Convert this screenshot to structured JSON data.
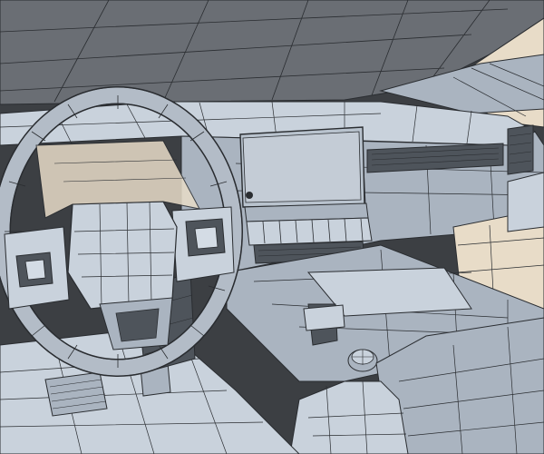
{
  "scene": {
    "subject": "car-interior-wireframe-render",
    "colors": {
      "background": "#3c3f43",
      "headliner": "#6a6e74",
      "surface_light": "#c9d2dc",
      "surface_mid": "#aab4c0",
      "surface_dark": "#8a939e",
      "shadow": "#4e545b",
      "wire": "#2a2d31",
      "warm_light": "#e8dcc8",
      "screen": "#b9c3ce"
    }
  }
}
